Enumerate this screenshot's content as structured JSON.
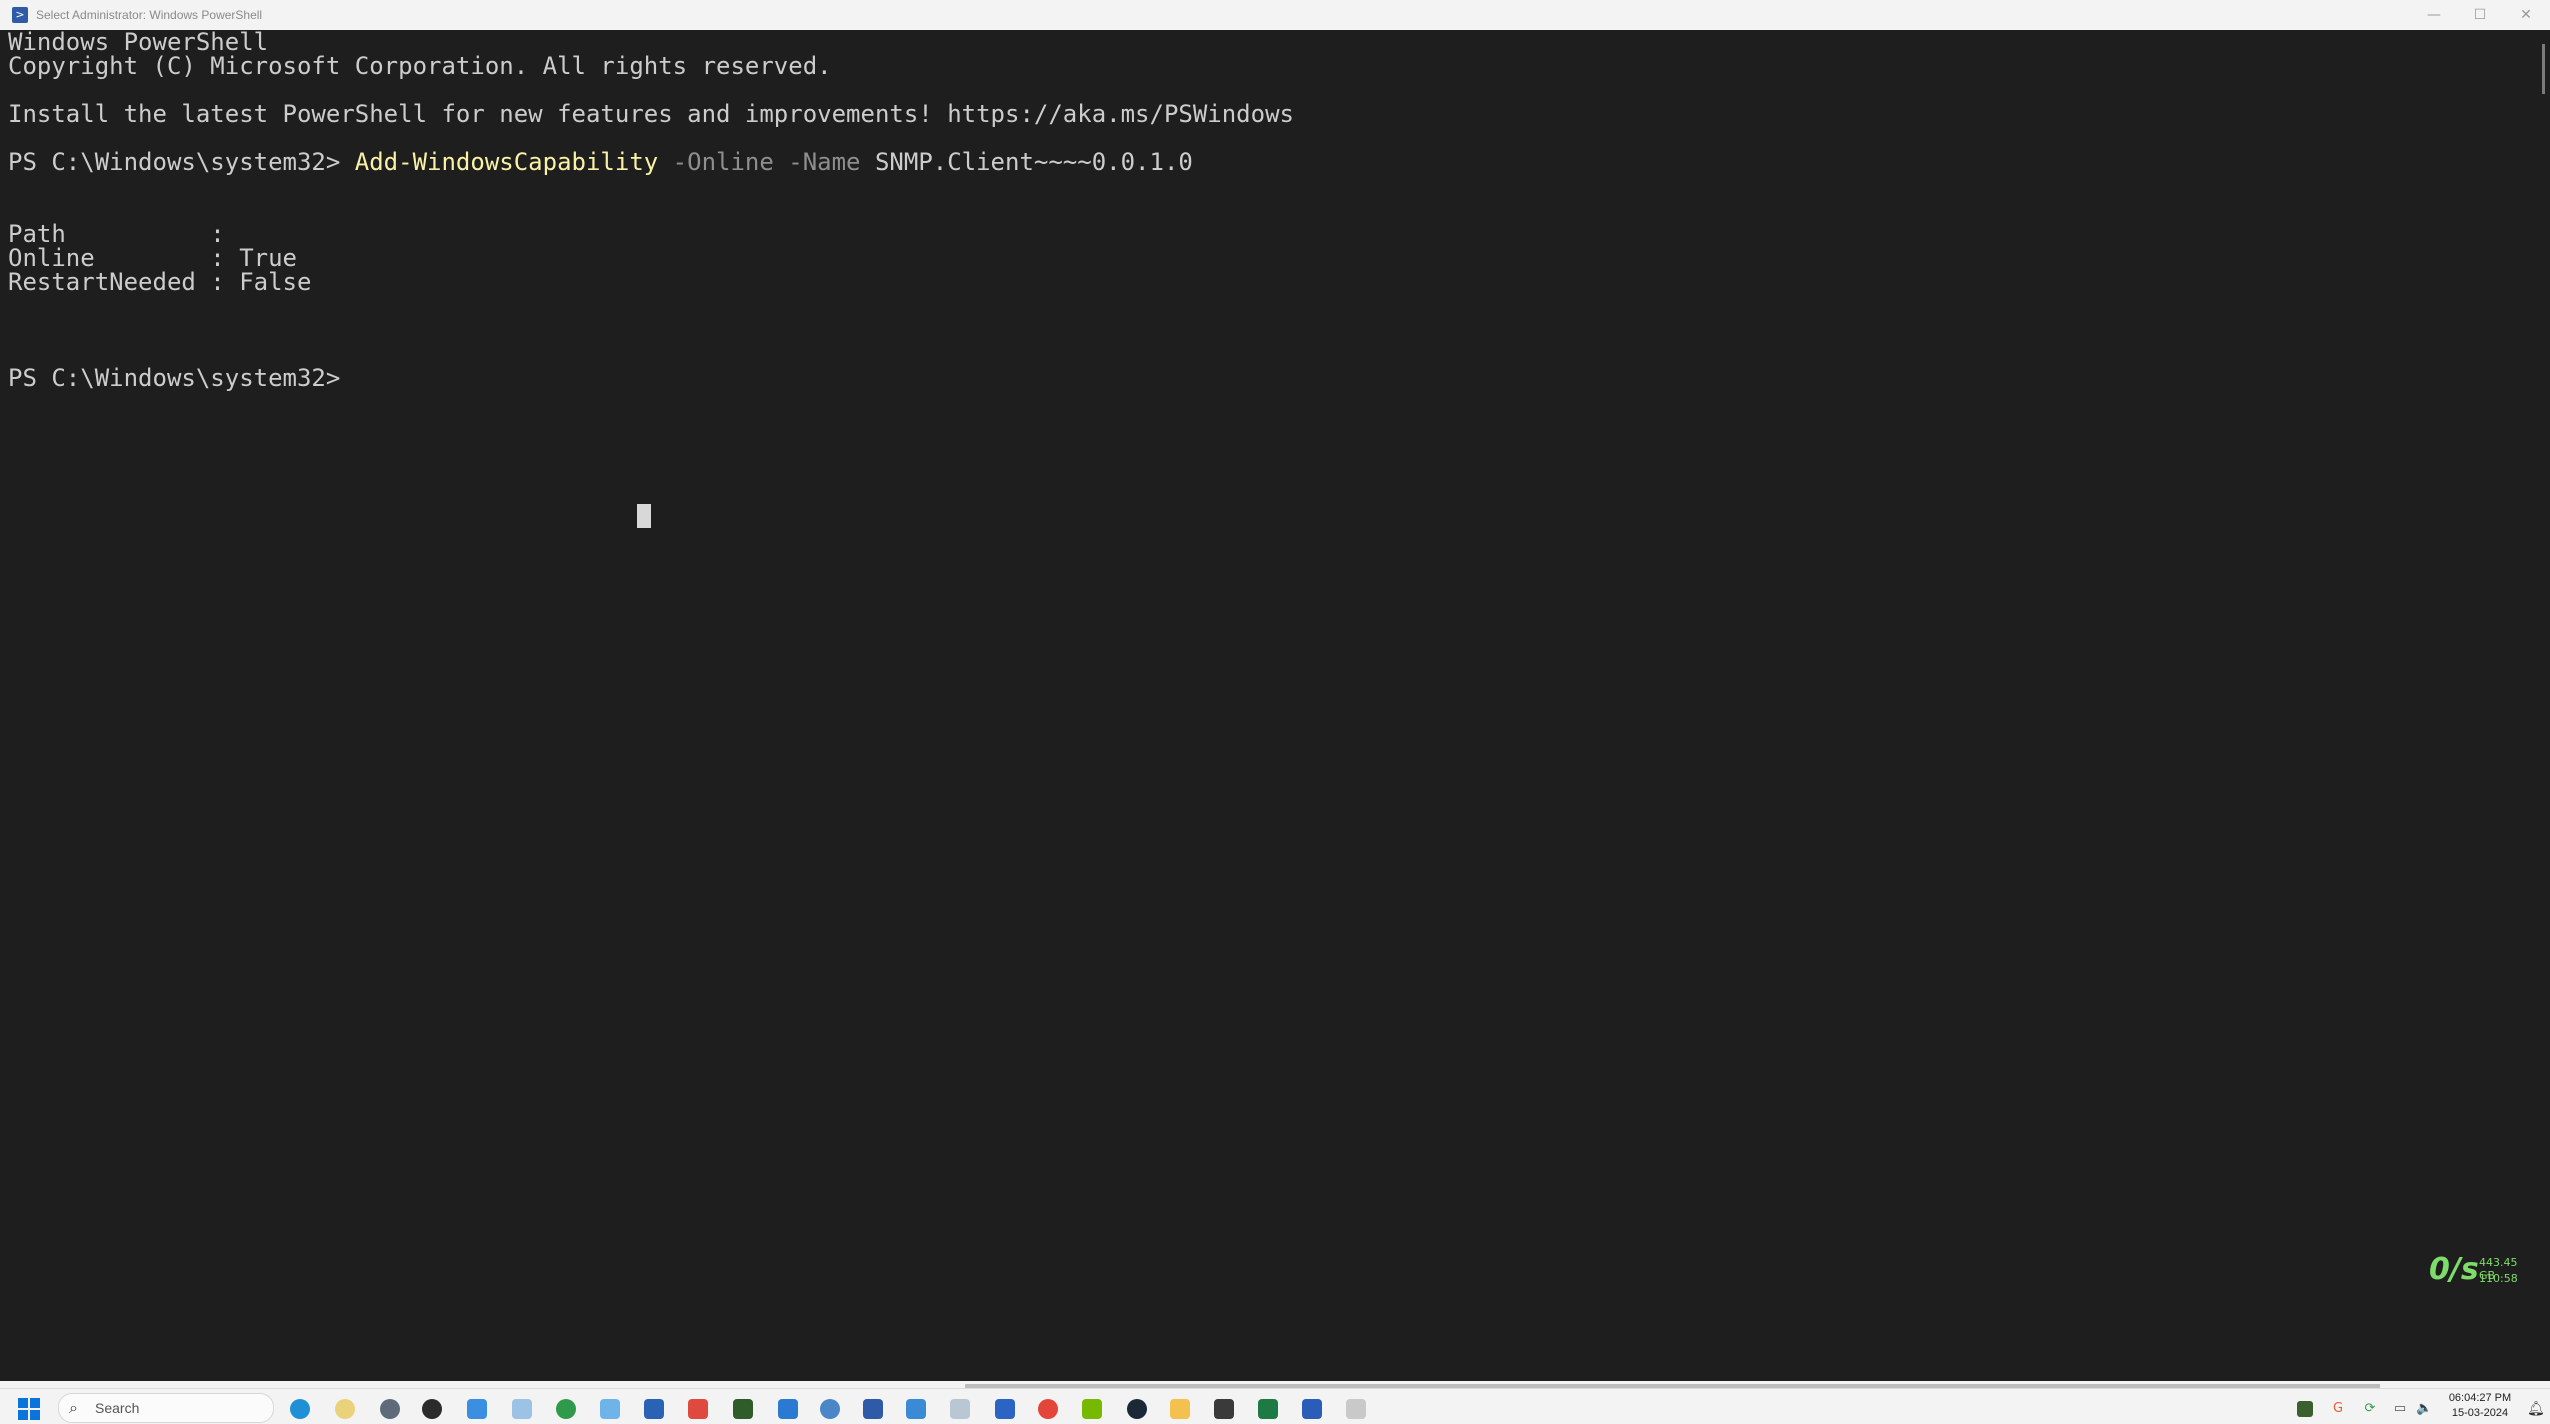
{
  "window": {
    "title": "Select Administrator: Windows PowerShell",
    "icon": "powershell-icon",
    "controls": {
      "minimize": "—",
      "maximize": "☐",
      "close": "✕"
    }
  },
  "console": {
    "header_line1": "Windows PowerShell",
    "header_line2": "Copyright (C) Microsoft Corporation. All rights reserved.",
    "header_line3": "Install the latest PowerShell for new features and improvements! https://aka.ms/PSWindows",
    "prompt1": "PS C:\\Windows\\system32> ",
    "command": "Add-WindowsCapability",
    "param1": " -Online",
    "param2": " -Name",
    "arg": " SNMP.Client~~~~0.0.1.0",
    "output": [
      "Path          :",
      "Online        : True",
      "RestartNeeded : False"
    ],
    "prompt2": "PS C:\\Windows\\system32>",
    "colors": {
      "background": "#1e1e1e",
      "text": "#cccccc",
      "command": "#f9f1a5",
      "parameter": "#8e8e8e"
    }
  },
  "overlay": {
    "rate": "0/s",
    "disk": "443.45 GB",
    "time": "110:58"
  },
  "taskbar": {
    "search_placeholder": "Search",
    "apps": [
      "edge-icon",
      "clock-app-icon",
      "settings-icon",
      "media-player-icon",
      "notepad-icon",
      "charts-app-icon",
      "browser-icon",
      "photos-icon",
      "store-icon",
      "snipping-tool-icon",
      "nvidia-icon",
      "vscode-icon",
      "r-studio-icon",
      "powershell-icon",
      "image-viewer-icon",
      "remote-desktop-icon",
      "teams-icon",
      "chrome-icon",
      "nvidia-control-icon",
      "steam-icon",
      "file-explorer-icon",
      "terminal-icon",
      "excel-icon",
      "word-icon",
      "clipboard-icon"
    ],
    "clock_time": "06:04:27 PM",
    "clock_date": "15-03-2024"
  }
}
